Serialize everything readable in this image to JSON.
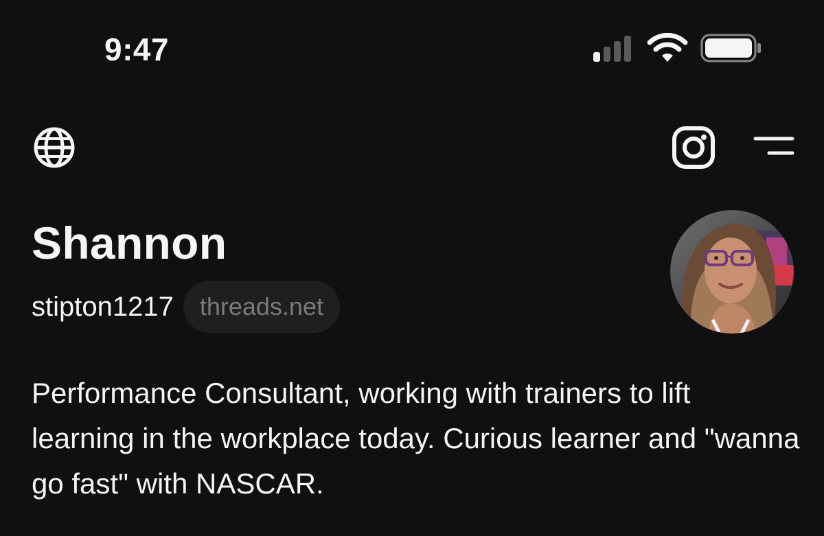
{
  "status_bar": {
    "time": "9:47",
    "cellular_icon": "signal-bars-icon",
    "wifi_icon": "wifi-icon",
    "battery_icon": "battery-icon"
  },
  "header": {
    "left_icon": "globe-icon",
    "instagram_icon": "instagram-icon",
    "menu_icon": "menu-icon"
  },
  "profile": {
    "name": "Shannon",
    "username": "stipton1217",
    "domain_badge": "threads.net",
    "avatar_icon": "avatar-photo",
    "bio": "Performance Consultant, working with trainers to lift learning in the workplace today. Curious learner and \"wanna go fast\" with NASCAR."
  },
  "colors": {
    "background": "#101010",
    "text": "#f3f5f7",
    "badge_bg": "#1f1f1f",
    "badge_text": "#7a7a7a"
  }
}
